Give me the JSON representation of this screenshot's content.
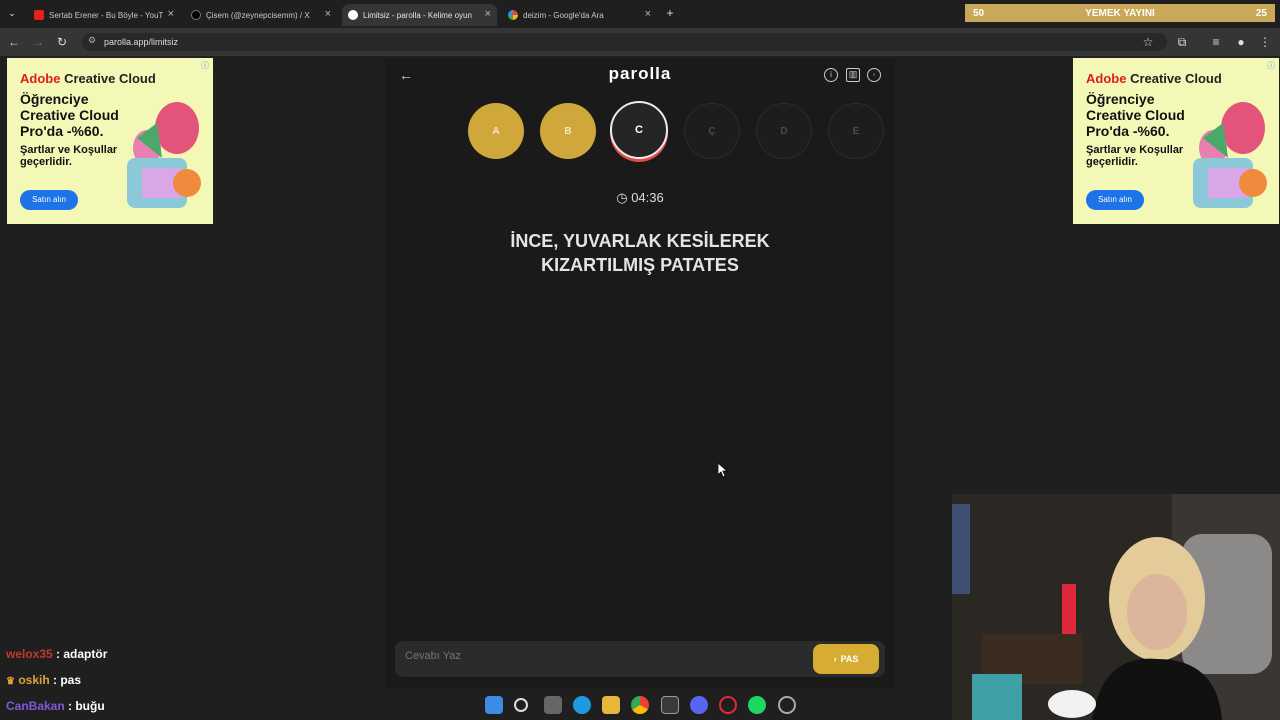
{
  "tabs": [
    {
      "title": "Sertab Erener - Bu Böyle - YouT",
      "favicon": "youtube-icon",
      "color": "#e62117"
    },
    {
      "title": "Çisem (@zeynepcisemm) / X",
      "favicon": "x-icon",
      "color": "#000000"
    },
    {
      "title": "Limitsiz - parolla - Kelime oyun",
      "favicon": "parolla-icon",
      "color": "#ffffff"
    },
    {
      "title": "deizim - Google'da Ara",
      "favicon": "google-icon",
      "color": "#4285f4"
    }
  ],
  "stream_bar": {
    "left": "50",
    "title": "YEMEK YAYINI",
    "right": "25"
  },
  "address": {
    "url": "parolla.app/limitsiz"
  },
  "ad": {
    "brand_prefix": "Adobe",
    "brand_rest": " Creative Cloud",
    "headline": "Öğrenciye Creative Cloud Pro'da -%60.",
    "sub": "Şartlar ve Koşullar geçerlidir.",
    "button": "Satın alın"
  },
  "game": {
    "logo": "parolla",
    "letters": [
      {
        "label": "A",
        "state": "done"
      },
      {
        "label": "B",
        "state": "done"
      },
      {
        "label": "C",
        "state": "current"
      },
      {
        "label": "Ç",
        "state": "todo"
      },
      {
        "label": "D",
        "state": "todo"
      },
      {
        "label": "E",
        "state": "todo"
      }
    ],
    "timer": "04:36",
    "question_line1": "İNCE, YUVARLAK KESİLEREK",
    "question_line2": "KIZARTILMIŞ PATATES",
    "answer_placeholder": "Cevabı Yaz",
    "pass_label": "PAS"
  },
  "chat": [
    {
      "user": "welox35",
      "msg": " : adaptör",
      "color": "#c0392b"
    },
    {
      "user": "oskih",
      "msg": " : pas",
      "color": "#e0a33a"
    },
    {
      "user": "CanBakan",
      "msg": " : buğu",
      "color": "#7b5bd6"
    }
  ],
  "colors": {
    "accent": "#d6ac33",
    "done": "#cfa73b",
    "current_ring": "#e04b4b"
  }
}
